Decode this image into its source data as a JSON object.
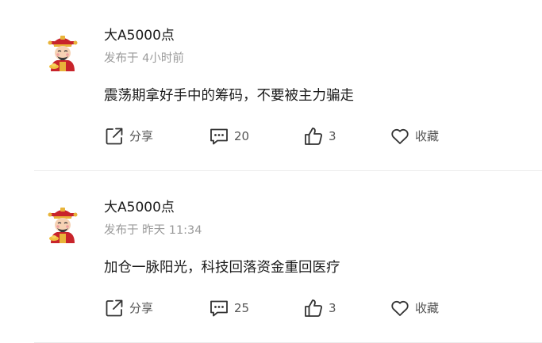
{
  "posts": [
    {
      "author": "大A5000点",
      "meta_prefix": "发布于",
      "meta_time": "4小时前",
      "content": "震荡期拿好手中的筹码，不要被主力骗走",
      "share_label": "分享",
      "comment_count": "20",
      "like_count": "3",
      "favorite_label": "收藏"
    },
    {
      "author": "大A5000点",
      "meta_prefix": "发布于",
      "meta_time": "昨天 11:34",
      "content": "加仓一脉阳光，科技回落资金重回医疗",
      "share_label": "分享",
      "comment_count": "25",
      "like_count": "3",
      "favorite_label": "收藏"
    }
  ],
  "icons": {
    "avatar": "caishen-avatar-icon",
    "share": "share-icon",
    "comment": "comment-icon",
    "like": "thumbs-up-icon",
    "favorite": "heart-icon"
  },
  "colors": {
    "text_primary": "#1a1a1a",
    "text_secondary": "#9a9a9a",
    "action_text": "#555555",
    "icon_stroke": "#333333",
    "divider": "#ececec"
  }
}
